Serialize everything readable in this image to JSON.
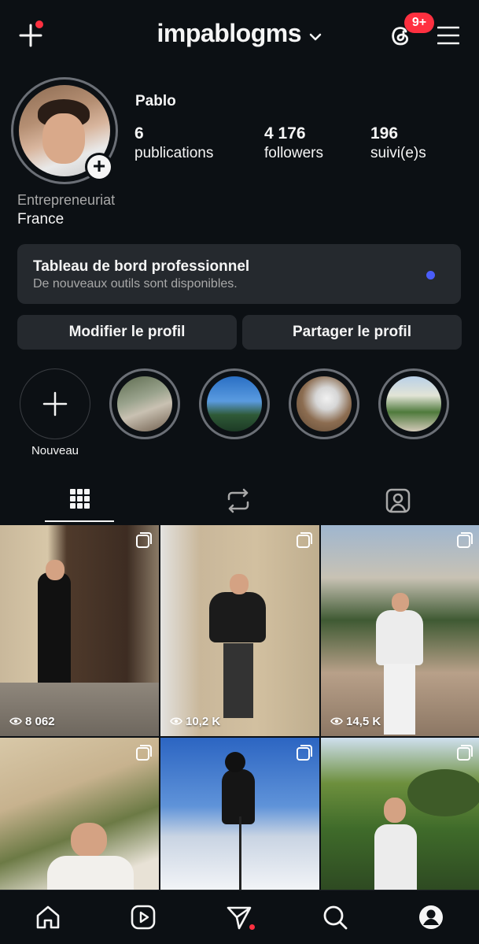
{
  "header": {
    "username": "impablogms",
    "notification_badge": "9+",
    "icons": {
      "create": "plus-icon",
      "threads": "threads-icon",
      "menu": "hamburger-menu-icon",
      "switch_account": "chevron-down-icon"
    }
  },
  "profile": {
    "display_name": "Pablo",
    "stats": [
      {
        "value": "6",
        "label": "publications"
      },
      {
        "value": "4 176",
        "label": "followers"
      },
      {
        "value": "196",
        "label": "suivi(e)s"
      }
    ],
    "category": "Entrepreneuriat",
    "location": "France"
  },
  "dashboard": {
    "title": "Tableau de bord professionnel",
    "subtitle": "De nouveaux outils sont disponibles."
  },
  "actions": {
    "edit_profile": "Modifier le profil",
    "share_profile": "Partager le profil"
  },
  "highlights": {
    "new_label": "Nouveau",
    "count": 4
  },
  "tabs": {
    "items": [
      "grid-icon",
      "reposts-icon",
      "tagged-icon"
    ],
    "active": "grid-icon"
  },
  "posts": [
    {
      "views": "8 062",
      "multi": true
    },
    {
      "views": "10,2 K",
      "multi": true
    },
    {
      "views": "14,5 K",
      "multi": true
    },
    {
      "views": "",
      "multi": true
    },
    {
      "views": "",
      "multi": true
    },
    {
      "views": "",
      "multi": true
    }
  ],
  "bottom_nav": {
    "items": [
      "home-icon",
      "reels-icon",
      "messages-icon",
      "search-icon",
      "profile-icon"
    ],
    "active": "profile-icon"
  },
  "colors": {
    "background": "#0c1014",
    "surface": "#25292e",
    "accent_red": "#ff3040",
    "accent_blue": "#4a5df9",
    "muted_text": "#a8a8a8"
  }
}
